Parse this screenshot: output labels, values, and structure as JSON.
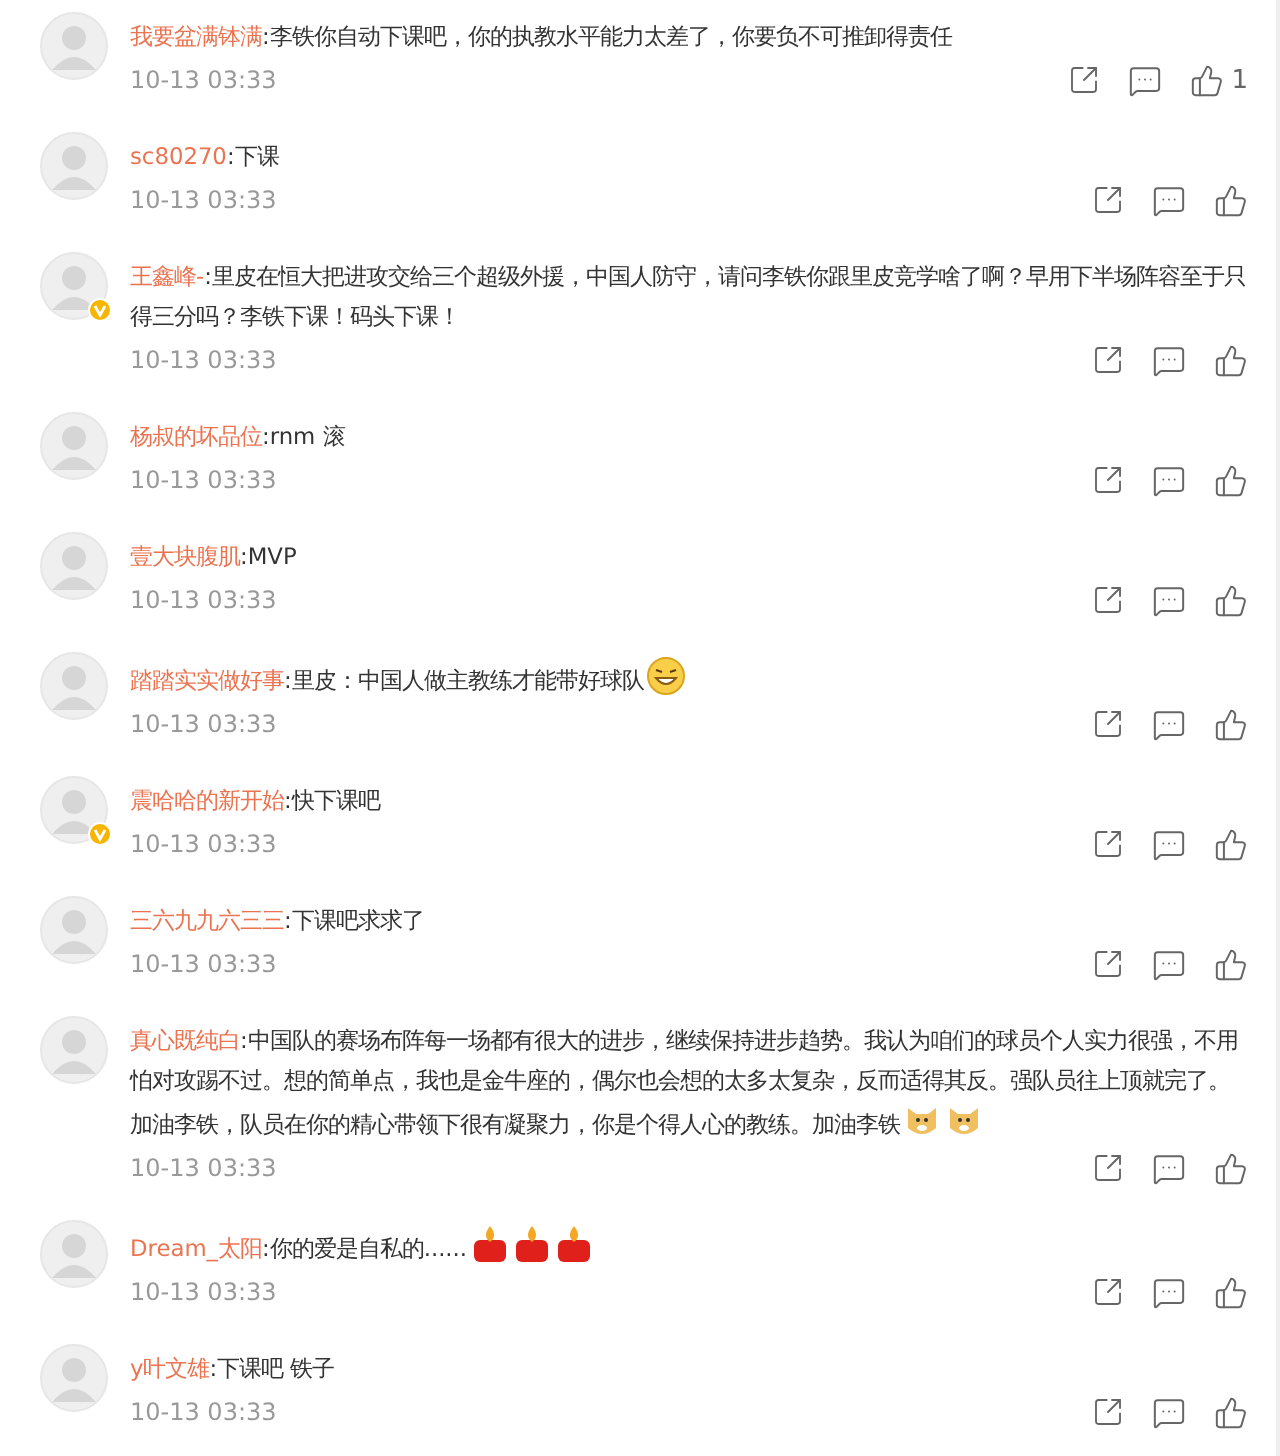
{
  "comments": [
    {
      "user": "我要盆满钵满",
      "text": ":李铁你自动下课吧，你的执教水平能力太差了，你要负不可推卸得责任",
      "time": "10-13 03:33",
      "verified": false,
      "likes": "1"
    },
    {
      "user": "sc80270",
      "text": ":下课",
      "time": "10-13 03:33",
      "verified": false
    },
    {
      "user": "王鑫峰-",
      "text": ":里皮在恒大把进攻交给三个超级外援，中国人防守，请问李铁你跟里皮竞学啥了啊？早用下半场阵容至于只得三分吗？李铁下课！码头下课！",
      "time": "10-13 03:33",
      "verified": true
    },
    {
      "user": "杨叔的坏品位",
      "text": ":rnm 滚",
      "time": "10-13 03:33",
      "verified": false
    },
    {
      "user": "壹大块腹肌",
      "text": ":MVP",
      "time": "10-13 03:33",
      "verified": false
    },
    {
      "user": "踏踏实实做好事",
      "text": ":里皮：中国人做主教练才能带好球队",
      "emojis": [
        {
          "kind": "grin"
        }
      ],
      "time": "10-13 03:33",
      "verified": false
    },
    {
      "user": "震哈哈的新开始",
      "text": ":快下课吧",
      "time": "10-13 03:33",
      "verified": true
    },
    {
      "user": "三六九九六三三",
      "text": ":下课吧求求了",
      "time": "10-13 03:33",
      "verified": false
    },
    {
      "user": "真心既纯白",
      "text": ":中国队的赛场布阵每一场都有很大的进步，继续保持进步趋势。我认为咱们的球员个人实力很强，不用怕对攻踢不过。想的简单点，我也是金牛座的，偶尔也会想的太多太复杂，反而适得其反。强队员往上顶就完了。加油李铁，队员在你的精心带领下很有凝聚力，你是个得人心的教练。加油李铁",
      "emojis": [
        {
          "kind": "doge"
        },
        {
          "kind": "doge"
        }
      ],
      "time": "10-13 03:33",
      "verified": false
    },
    {
      "user": "Dream_太阳",
      "text": ":你的爱是自私的......",
      "emojis": [
        {
          "kind": "candle"
        },
        {
          "kind": "candle"
        },
        {
          "kind": "candle"
        }
      ],
      "time": "10-13 03:33",
      "verified": false
    },
    {
      "user": "y叶文雄",
      "text": ":下课吧 铁子",
      "time": "10-13 03:33",
      "verified": false
    }
  ]
}
